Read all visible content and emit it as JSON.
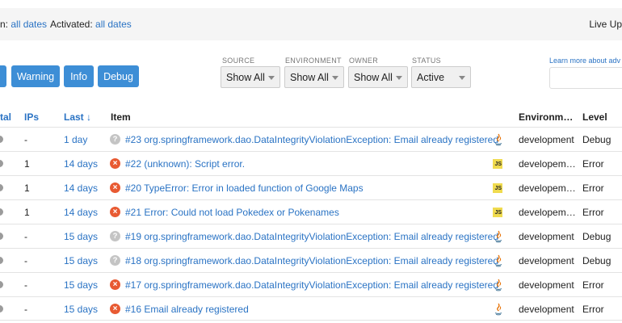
{
  "filters": {
    "seen_label": "n:",
    "seen_value": "all dates",
    "activated_label": "Activated:",
    "activated_value": "all dates",
    "live": "Live Up"
  },
  "buttons": {
    "first": "",
    "warning": "Warning",
    "info": "Info",
    "debug": "Debug"
  },
  "selects": [
    {
      "label": "SOURCE",
      "value": "Show All"
    },
    {
      "label": "ENVIRONMENT",
      "value": "Show All"
    },
    {
      "label": "OWNER",
      "value": "Show All"
    },
    {
      "label": "STATUS",
      "value": "Active"
    }
  ],
  "learn_more": "Learn more about adv",
  "table": {
    "headers": {
      "total": "tal",
      "ips": "IPs",
      "last": "Last ↓",
      "item": "Item",
      "environment": "Environm…",
      "level": "Level"
    },
    "rows": [
      {
        "ips": "-",
        "last": "1 day",
        "kind": "debug",
        "item": "#23 org.springframework.dao.DataIntegrityViolationException: Email already registered",
        "platform": "java",
        "environment": "development",
        "level": "Debug"
      },
      {
        "ips": "1",
        "last": "14 days",
        "kind": "error",
        "item": "#22 (unknown): Script error.",
        "platform": "js",
        "environment": "developem…",
        "level": "Error"
      },
      {
        "ips": "1",
        "last": "14 days",
        "kind": "error",
        "item": "#20 TypeError: Error in loaded function of Google Maps",
        "platform": "js",
        "environment": "developem…",
        "level": "Error"
      },
      {
        "ips": "1",
        "last": "14 days",
        "kind": "error",
        "item": "#21 Error: Could not load Pokedex or Pokenames",
        "platform": "js",
        "environment": "developem…",
        "level": "Error"
      },
      {
        "ips": "-",
        "last": "15 days",
        "kind": "debug",
        "item": "#19 org.springframework.dao.DataIntegrityViolationException: Email already registered",
        "platform": "java",
        "environment": "development",
        "level": "Debug"
      },
      {
        "ips": "-",
        "last": "15 days",
        "kind": "debug",
        "item": "#18 org.springframework.dao.DataIntegrityViolationException: Email already registered",
        "platform": "java",
        "environment": "development",
        "level": "Debug"
      },
      {
        "ips": "-",
        "last": "15 days",
        "kind": "error",
        "item": "#17 org.springframework.dao.DataIntegrityViolationException: Email already registered",
        "platform": "java",
        "environment": "development",
        "level": "Error"
      },
      {
        "ips": "-",
        "last": "15 days",
        "kind": "error",
        "item": "#16 Email already registered",
        "platform": "java",
        "environment": "development",
        "level": "Error"
      }
    ]
  }
}
